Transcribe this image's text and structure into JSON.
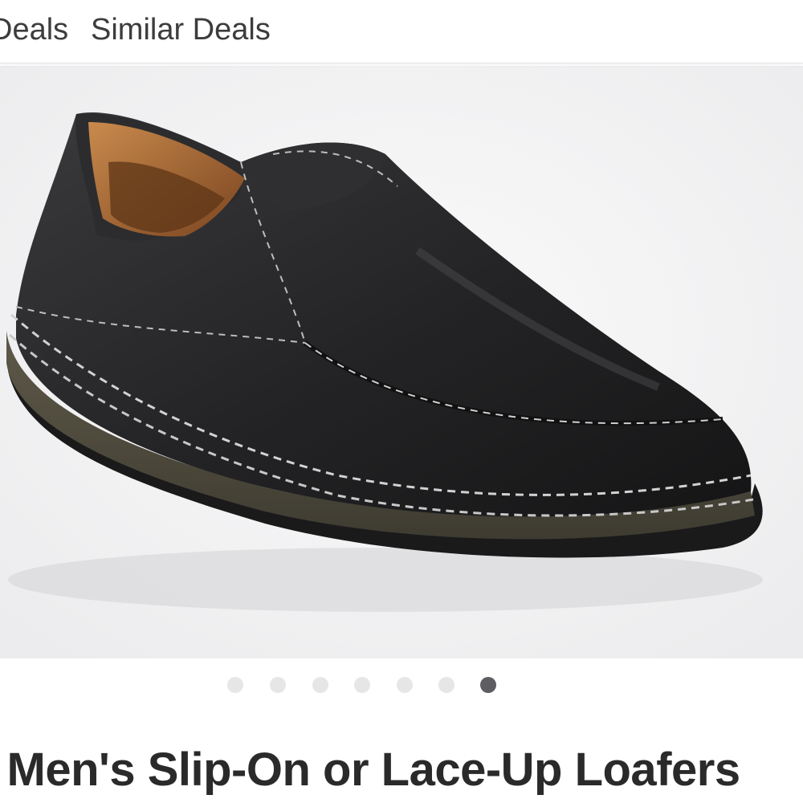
{
  "tabs": {
    "previous_label": "Deals",
    "similar_label": "Similar Deals"
  },
  "gallery": {
    "image_alt": "Black leather slip-on loafer",
    "slide_count": 7,
    "active_slide": 7
  },
  "product": {
    "title": "o Men's Slip-On or Lace-Up Loafers"
  },
  "colors": {
    "active_dot": "#5d5d62",
    "inactive_dot": "#e6e6e6",
    "title_text": "#2a2a2a"
  }
}
